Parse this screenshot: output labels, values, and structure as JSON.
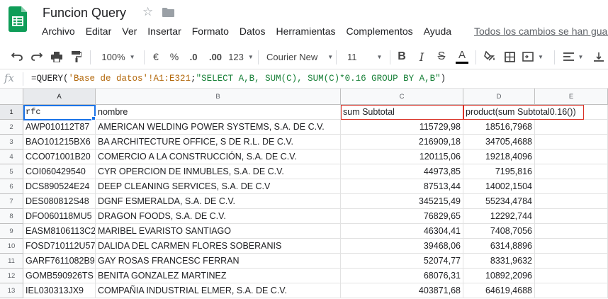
{
  "document": {
    "title": "Funcion Query",
    "save_status": "Todos los cambios se han guar"
  },
  "menu": [
    "Archivo",
    "Editar",
    "Ver",
    "Insertar",
    "Formato",
    "Datos",
    "Herramientas",
    "Complementos",
    "Ayuda"
  ],
  "toolbar": {
    "zoom": "100%",
    "currency": "€",
    "percent": "%",
    "decrease_decimals": ".0",
    "increase_decimals": ".00",
    "more_formats": "123",
    "font_family": "Courier New",
    "font_size": "11",
    "bold": "B",
    "italic": "I",
    "strikethrough": "S",
    "text_color": "A"
  },
  "formula_bar": {
    "fx_label": "fx",
    "formula_prefix": "=QUERY(",
    "formula_range": "'Base de datos'!A1:E321",
    "formula_sep": ";",
    "formula_query": "\"SELECT A,B, SUM(C), SUM(C)*0.16 GROUP BY A,B\"",
    "formula_suffix": ")"
  },
  "grid": {
    "columns": [
      "A",
      "B",
      "C",
      "D",
      "E"
    ],
    "row_numbers": [
      "1",
      "2",
      "3",
      "4",
      "5",
      "6",
      "7",
      "8",
      "9",
      "10",
      "11",
      "12",
      "13"
    ],
    "header_row": {
      "a": "rfc",
      "b": "nombre",
      "c": "sum Subtotal",
      "d": "product(sum Subtotal0.16())"
    },
    "rows": [
      {
        "rfc": "AWP010112T87",
        "nombre": "AMERICAN WELDING POWER SYSTEMS, S.A. DE C.V.",
        "sum": "115729,98",
        "product": "18516,7968"
      },
      {
        "rfc": "BAO101215BX6",
        "nombre": "BA ARCHITECTURE OFFICE, S DE R.L. DE C.V.",
        "sum": "216909,18",
        "product": "34705,4688"
      },
      {
        "rfc": "CCO071001B20",
        "nombre": "COMERCIO A LA CONSTRUCCIÓN, S.A. DE C.V.",
        "sum": "120115,06",
        "product": "19218,4096"
      },
      {
        "rfc": "COI060429540",
        "nombre": "CYR OPERCION DE INMUBLES, S.A. DE C.V.",
        "sum": "44973,85",
        "product": "7195,816"
      },
      {
        "rfc": "DCS890524E24",
        "nombre": "DEEP CLEANING SERVICES, S.A. DE C.V",
        "sum": "87513,44",
        "product": "14002,1504"
      },
      {
        "rfc": "DES080812S48",
        "nombre": "DGNF ESMERALDA, S.A. DE C.V.",
        "sum": "345215,49",
        "product": "55234,4784"
      },
      {
        "rfc": "DFO060118MU5",
        "nombre": "DRAGON FOODS, S.A. DE C.V.",
        "sum": "76829,65",
        "product": "12292,744"
      },
      {
        "rfc": "EASM8106113C2",
        "nombre": "MARIBEL EVARISTO SANTIAGO",
        "sum": "46304,41",
        "product": "7408,7056"
      },
      {
        "rfc": "FOSD710112U57",
        "nombre": "DALIDA DEL CARMEN FLORES SOBERANIS",
        "sum": "39468,06",
        "product": "6314,8896"
      },
      {
        "rfc": "GARF7611082B9",
        "nombre": "GAY ROSAS FRANCESC FERRAN",
        "sum": "52074,77",
        "product": "8331,9632"
      },
      {
        "rfc": "GOMB590926TS",
        "nombre": "BENITA GONZALEZ MARTINEZ",
        "sum": "68076,31",
        "product": "10892,2096"
      },
      {
        "rfc": "IEL030313JX9",
        "nombre": "COMPAÑIA INDUSTRIAL ELMER, S.A. DE C.V.",
        "sum": "403871,68",
        "product": "64619,4688"
      }
    ]
  },
  "colors": {
    "sheets_green": "#0f9d58",
    "selection_blue": "#1a73e8",
    "highlight_red": "#d93025",
    "formula_range": "#b2670a",
    "formula_query": "#188038"
  }
}
